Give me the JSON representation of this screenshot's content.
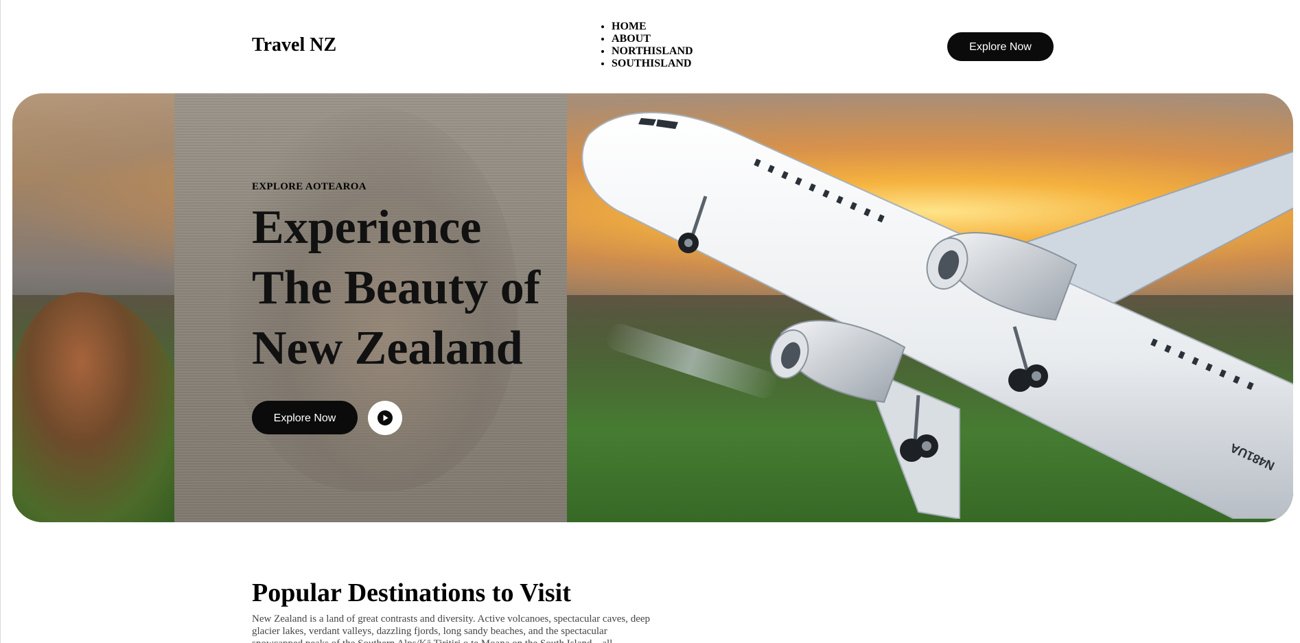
{
  "header": {
    "brand": "Travel NZ",
    "nav": [
      "HOME",
      "ABOUT",
      "NORTHISLAND",
      "SOUTHISLAND"
    ],
    "cta_label": "Explore Now"
  },
  "hero": {
    "eyebrow": "EXPLORE AOTEAROA",
    "title_lines": [
      "Experience",
      "The Beauty of",
      "New Zealand"
    ],
    "cta_label": "Explore Now",
    "plane_registration": "N481UA",
    "play_icon": "play-icon"
  },
  "destinations": {
    "title": "Popular Destinations to Visit",
    "text": "New Zealand is a land of great contrasts and diversity. Active volcanoes, spectacular caves, deep glacier lakes, verdant valleys, dazzling fjords, long sandy beaches, and the spectacular snowcapped peaks of the Southern Alps/Kā Tiritiri o te Moana on the South Island – all"
  },
  "colors": {
    "button_bg": "#0b0b0b",
    "button_text": "#ffffff",
    "page_bg": "#ffffff"
  }
}
